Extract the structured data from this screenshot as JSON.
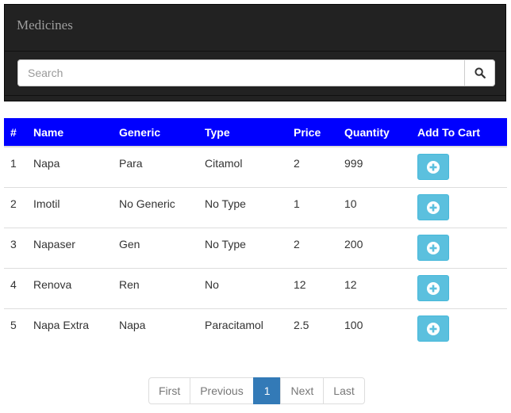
{
  "navbar": {
    "brand": "Medicines"
  },
  "search": {
    "placeholder": "Search"
  },
  "table": {
    "headers": [
      "#",
      "Name",
      "Generic",
      "Type",
      "Price",
      "Quantity",
      "Add To Cart"
    ],
    "rows": [
      [
        "1",
        "Napa",
        "Para",
        "Citamol",
        "2",
        "999"
      ],
      [
        "2",
        "Imotil",
        "No Generic",
        "No Type",
        "1",
        "10"
      ],
      [
        "3",
        "Napaser",
        "Gen",
        "No Type",
        "2",
        "200"
      ],
      [
        "4",
        "Renova",
        "Ren",
        "No",
        "12",
        "12"
      ],
      [
        "5",
        "Napa Extra",
        "Napa",
        "Paracitamol",
        "2.5",
        "100"
      ]
    ]
  },
  "pagination": {
    "first": "First",
    "previous": "Previous",
    "current": "1",
    "next": "Next",
    "last": "Last"
  },
  "colors": {
    "header_bg": "#0000ff",
    "navbar_bg": "#222222",
    "cart_button": "#5bc0de",
    "active_page": "#337ab7"
  },
  "icons": {
    "search": "search-icon",
    "add": "plus-circle-icon"
  }
}
